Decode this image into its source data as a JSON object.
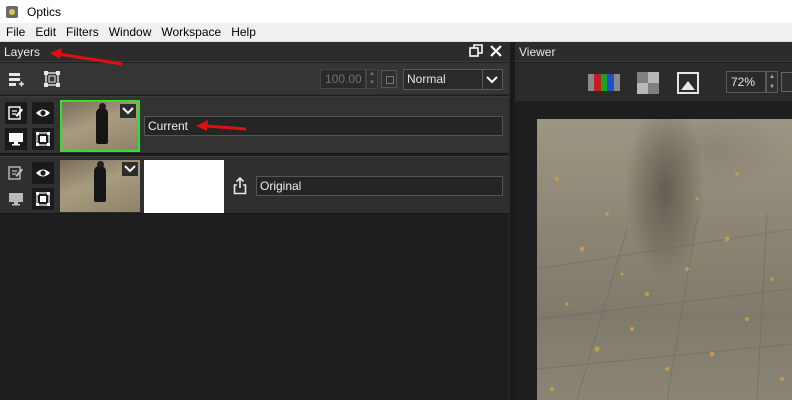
{
  "window": {
    "title": "Optics"
  },
  "menu": [
    "File",
    "Edit",
    "Filters",
    "Window",
    "Workspace",
    "Help"
  ],
  "layers_panel": {
    "title": "Layers",
    "opacity": "100.00",
    "blend_mode": "Normal",
    "layers": [
      {
        "name": "Current",
        "selected": true
      },
      {
        "name": "Original",
        "selected": false
      }
    ]
  },
  "viewer_panel": {
    "title": "Viewer",
    "zoom": "72%"
  },
  "colors": {
    "accent_green": "#2ee22e",
    "annotation_red": "#e01010",
    "panel_bg": "#1e1e1e"
  },
  "icons": [
    "app-icon",
    "float-icon",
    "close-icon",
    "add-layer-icon",
    "transform-icon",
    "edit-icon",
    "eye-icon",
    "monitor-icon",
    "mask-icon",
    "chevron-down-icon",
    "share-icon",
    "rgb-channels-icon",
    "checker-icon",
    "image-icon"
  ]
}
